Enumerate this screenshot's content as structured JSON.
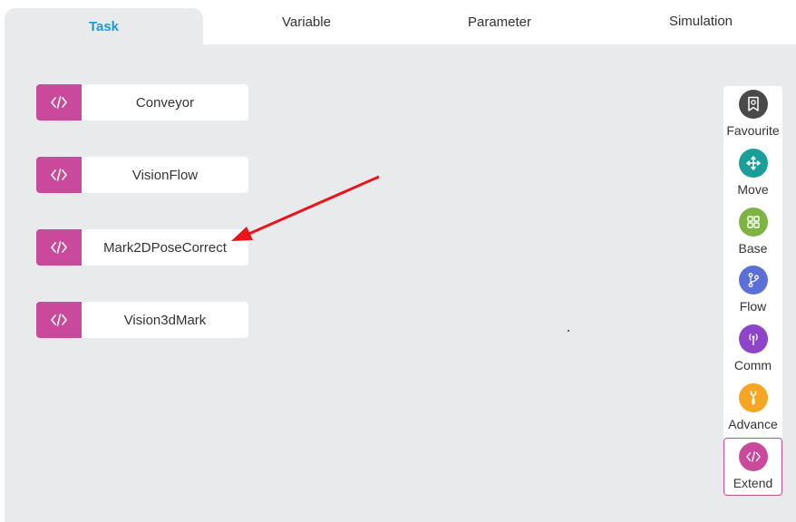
{
  "tabs": [
    {
      "label": "Task"
    },
    {
      "label": "Variable"
    },
    {
      "label": "Parameter"
    },
    {
      "label": "Simulation"
    }
  ],
  "blocks": [
    {
      "label": "Conveyor",
      "icon": "code-icon"
    },
    {
      "label": "VisionFlow",
      "icon": "code-icon"
    },
    {
      "label": "Mark2DPoseCorrect",
      "icon": "code-icon"
    },
    {
      "label": "Vision3dMark",
      "icon": "code-icon"
    }
  ],
  "palette": [
    {
      "label": "Favourite",
      "icon": "bookmark-icon",
      "color": "#4a4a4a"
    },
    {
      "label": "Move",
      "icon": "move-icon",
      "color": "#1a9e9a"
    },
    {
      "label": "Base",
      "icon": "grid-icon",
      "color": "#7cb342"
    },
    {
      "label": "Flow",
      "icon": "branch-icon",
      "color": "#5b6fd8"
    },
    {
      "label": "Comm",
      "icon": "antenna-icon",
      "color": "#8e44c9"
    },
    {
      "label": "Advance",
      "icon": "wrench-icon",
      "color": "#f5a623"
    },
    {
      "label": "Extend",
      "icon": "code-icon",
      "color": "#c94a9c"
    }
  ],
  "colors": {
    "accent": "#1d9ad6",
    "block_icon": "#c94a9c",
    "workspace": "#e9eaec",
    "arrow": "#e8161b"
  }
}
